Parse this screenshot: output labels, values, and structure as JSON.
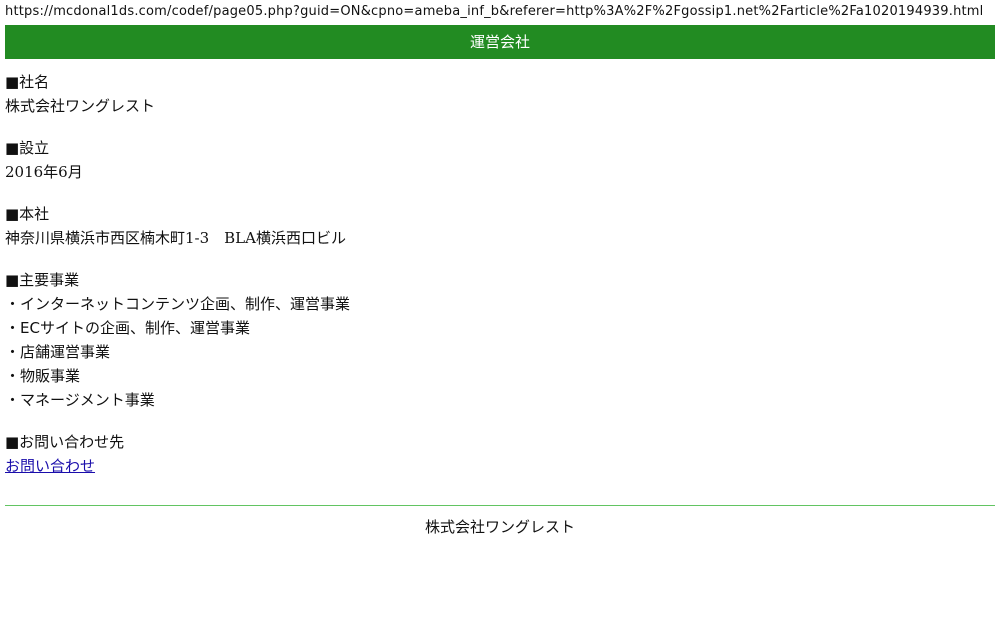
{
  "url": "https://mcdonal1ds.com/codef/page05.php?guid=ON&cpno=ameba_inf_b&referer=http%3A%2F%2Fgossip1.net%2Farticle%2Fa1020194939.html",
  "header": {
    "title": "運営会社"
  },
  "company_name": {
    "heading": "■社名",
    "value": "株式会社ワングレスト"
  },
  "established": {
    "heading": "■設立",
    "value": "2016年6月"
  },
  "headquarters": {
    "heading": "■本社",
    "value": "神奈川県横浜市西区楠木町1-3　BLA横浜西口ビル"
  },
  "business": {
    "heading": "■主要事業",
    "items": [
      "・インターネットコンテンツ企画、制作、運営事業",
      "・ECサイトの企画、制作、運営事業",
      "・店舗運営事業",
      "・物販事業",
      "・マネージメント事業"
    ]
  },
  "contact": {
    "heading": "■お問い合わせ先",
    "link_label": "お問い合わせ"
  },
  "footer": {
    "text": "株式会社ワングレスト"
  },
  "colors": {
    "header_bg": "#228b22",
    "link": "#1a0dab",
    "divider": "#62c462"
  }
}
